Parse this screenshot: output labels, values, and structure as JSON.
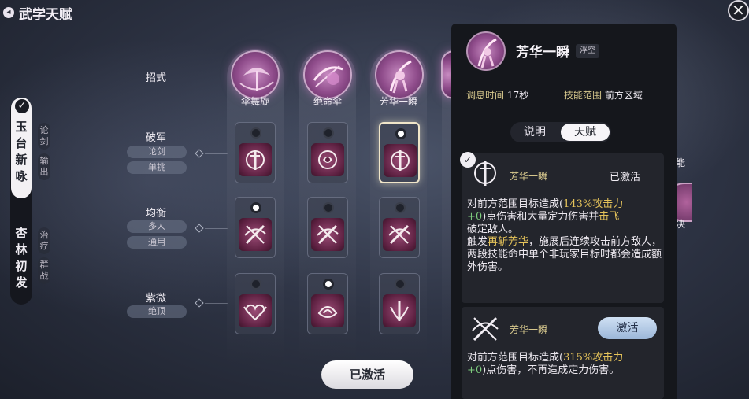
{
  "header": {
    "title": "武学天赋",
    "back_icon": "back-icon"
  },
  "close_icon": "close-icon",
  "tabs": [
    {
      "label": "玉台新咏",
      "tags": [
        "论剑",
        "输出"
      ],
      "selected": true
    },
    {
      "label": "杏林初发",
      "tags": [
        "治疗",
        "群战"
      ],
      "selected": false
    }
  ],
  "row_header": "招式",
  "rows": [
    {
      "label": "破军",
      "tags": [
        "论剑",
        "单挑"
      ]
    },
    {
      "label": "均衡",
      "tags": [
        "多人",
        "通用"
      ]
    },
    {
      "label": "紫微",
      "tags": [
        "绝顶"
      ]
    }
  ],
  "moves": [
    {
      "name": "伞舞旋"
    },
    {
      "name": "绝命伞"
    },
    {
      "name": "芳华一瞬"
    }
  ],
  "selection": {
    "row0": [
      false,
      false,
      true
    ],
    "row1": [
      true,
      false,
      false
    ],
    "row2": [
      false,
      true,
      false
    ]
  },
  "activated_button": "已激活",
  "right_peek": {
    "text_top": "能",
    "text_bottom": "决"
  },
  "panel": {
    "title": "芳华一瞬",
    "badge": "浮空",
    "cooldown_label": "调息时间",
    "cooldown_value": "17秒",
    "range_label": "技能范围",
    "range_value": "前方区域",
    "toggle": [
      "说明",
      "天赋"
    ],
    "toggle_selected": "天赋",
    "card1": {
      "name": "芳华一瞬",
      "status": "已激活",
      "desc_a": "对前方范围目标造成(",
      "desc_b": "143%攻击力",
      "desc_c": "+0",
      "desc_d": ")点伤害和大量定力伤害并",
      "desc_e": "击飞",
      "desc_f": "破定敌人。",
      "desc_g": "触发",
      "desc_h": "再斩芳华",
      "desc_i": "，施展后连续攻击前方敌人，两段技能命中单个非玩家目标时都会造成额外伤害。"
    },
    "card2": {
      "name": "芳华一瞬",
      "button": "激活",
      "desc_a": "对前方范围目标造成(",
      "desc_b": "315%攻击力",
      "desc_c": "+0",
      "desc_d": ")点伤害，不再造成定力伤害。"
    }
  }
}
